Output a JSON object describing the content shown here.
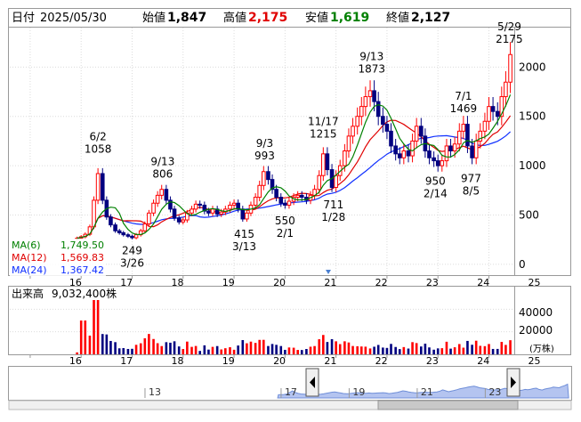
{
  "header": {
    "date_label": "日付",
    "date_value": "2025/05/30",
    "open_label": "始値",
    "open_value": "1,847",
    "high_label": "高値",
    "high_value": "2,175",
    "low_label": "安値",
    "low_value": "1,619",
    "close_label": "終値",
    "close_value": "2,127"
  },
  "colors": {
    "up": "#ff0000",
    "down": "#000080",
    "ma6": "#008000",
    "ma12": "#e00000",
    "ma24": "#1030ff",
    "high_text": "#e00000",
    "low_text": "#008000",
    "volume_up": "#ff0000",
    "volume_down": "#000080",
    "navigator_fill": "#b4c4f0"
  },
  "legend": [
    {
      "label": "MA(6)",
      "value": "1,749.50"
    },
    {
      "label": "MA(12)",
      "value": "1,569.83"
    },
    {
      "label": "MA(24)",
      "value": "1,367.42"
    }
  ],
  "volume_panel": {
    "label": "出来高",
    "value": "9,032,400株",
    "unit": "(万株)",
    "yticks": [
      "40000",
      "20000"
    ]
  },
  "chart_data": [
    {
      "type": "candlestick",
      "ylim": [
        -100,
        2400
      ],
      "yticks": [
        0,
        500,
        1000,
        1500,
        2000
      ],
      "x_tick_labels": [
        "16",
        "17",
        "18",
        "19",
        "20",
        "21",
        "22",
        "23",
        "24",
        "25"
      ],
      "x_tick_years": [
        2016,
        2017,
        2018,
        2019,
        2020,
        2021,
        2022,
        2023,
        2024,
        2025
      ],
      "x_range": [
        2015.6,
        2025.48
      ],
      "annotations": [
        {
          "date": "6/2",
          "value": "1058",
          "x": 2017.33,
          "y": 1058,
          "pos": "above"
        },
        {
          "date": "3/26",
          "value": "249",
          "x": 2018.0,
          "y": 249,
          "pos": "below"
        },
        {
          "date": "9/13",
          "value": "806",
          "x": 2018.6,
          "y": 806,
          "pos": "above"
        },
        {
          "date": "3/13",
          "value": "415",
          "x": 2020.2,
          "y": 415,
          "pos": "below"
        },
        {
          "date": "9/3",
          "value": "993",
          "x": 2020.6,
          "y": 993,
          "pos": "above"
        },
        {
          "date": "2/1",
          "value": "550",
          "x": 2021.0,
          "y": 550,
          "pos": "below"
        },
        {
          "date": "11/17",
          "value": "1215",
          "x": 2021.75,
          "y": 1215,
          "pos": "above"
        },
        {
          "date": "1/28",
          "value": "711",
          "x": 2021.95,
          "y": 711,
          "pos": "below"
        },
        {
          "date": "9/13",
          "value": "1873",
          "x": 2022.7,
          "y": 1873,
          "pos": "above"
        },
        {
          "date": "2/14",
          "value": "950",
          "x": 2023.95,
          "y": 950,
          "pos": "below"
        },
        {
          "date": "7/1",
          "value": "1469",
          "x": 2024.5,
          "y": 1469,
          "pos": "above"
        },
        {
          "date": "8/5",
          "value": "977",
          "x": 2024.65,
          "y": 977,
          "pos": "below"
        },
        {
          "date": "5/29",
          "value": "2175",
          "x": 2025.4,
          "y": 2175,
          "pos": "above"
        }
      ],
      "close_series_monthly": [
        [
          2016.92,
          265
        ],
        [
          2017.0,
          280
        ],
        [
          2017.08,
          305
        ],
        [
          2017.17,
          380
        ],
        [
          2017.25,
          650
        ],
        [
          2017.33,
          920
        ],
        [
          2017.42,
          650
        ],
        [
          2017.5,
          480
        ],
        [
          2017.58,
          400
        ],
        [
          2017.67,
          340
        ],
        [
          2017.75,
          320
        ],
        [
          2017.83,
          300
        ],
        [
          2017.92,
          285
        ],
        [
          2018.0,
          270
        ],
        [
          2018.08,
          300
        ],
        [
          2018.17,
          340
        ],
        [
          2018.25,
          410
        ],
        [
          2018.33,
          520
        ],
        [
          2018.42,
          620
        ],
        [
          2018.5,
          700
        ],
        [
          2018.58,
          760
        ],
        [
          2018.67,
          650
        ],
        [
          2018.75,
          560
        ],
        [
          2018.83,
          470
        ],
        [
          2018.92,
          430
        ],
        [
          2019.0,
          450
        ],
        [
          2019.08,
          520
        ],
        [
          2019.17,
          560
        ],
        [
          2019.25,
          610
        ],
        [
          2019.33,
          600
        ],
        [
          2019.42,
          540
        ],
        [
          2019.5,
          520
        ],
        [
          2019.58,
          560
        ],
        [
          2019.67,
          510
        ],
        [
          2019.75,
          530
        ],
        [
          2019.83,
          560
        ],
        [
          2019.92,
          600
        ],
        [
          2020.0,
          620
        ],
        [
          2020.08,
          560
        ],
        [
          2020.17,
          460
        ],
        [
          2020.25,
          520
        ],
        [
          2020.33,
          600
        ],
        [
          2020.42,
          680
        ],
        [
          2020.5,
          800
        ],
        [
          2020.58,
          940
        ],
        [
          2020.67,
          860
        ],
        [
          2020.75,
          760
        ],
        [
          2020.83,
          680
        ],
        [
          2020.92,
          620
        ],
        [
          2021.0,
          600
        ],
        [
          2021.08,
          640
        ],
        [
          2021.17,
          680
        ],
        [
          2021.25,
          700
        ],
        [
          2021.33,
          680
        ],
        [
          2021.42,
          650
        ],
        [
          2021.5,
          700
        ],
        [
          2021.58,
          760
        ],
        [
          2021.67,
          900
        ],
        [
          2021.75,
          1120
        ],
        [
          2021.83,
          960
        ],
        [
          2021.92,
          780
        ],
        [
          2022.0,
          900
        ],
        [
          2022.08,
          1000
        ],
        [
          2022.17,
          1150
        ],
        [
          2022.25,
          1300
        ],
        [
          2022.33,
          1400
        ],
        [
          2022.42,
          1500
        ],
        [
          2022.5,
          1600
        ],
        [
          2022.58,
          1700
        ],
        [
          2022.67,
          1760
        ],
        [
          2022.75,
          1650
        ],
        [
          2022.83,
          1500
        ],
        [
          2022.92,
          1420
        ],
        [
          2023.0,
          1350
        ],
        [
          2023.08,
          1200
        ],
        [
          2023.17,
          1120
        ],
        [
          2023.25,
          1080
        ],
        [
          2023.33,
          1150
        ],
        [
          2023.42,
          1100
        ],
        [
          2023.5,
          1250
        ],
        [
          2023.58,
          1400
        ],
        [
          2023.67,
          1300
        ],
        [
          2023.75,
          1150
        ],
        [
          2023.83,
          1080
        ],
        [
          2023.92,
          1050
        ],
        [
          2024.0,
          1000
        ],
        [
          2024.08,
          1050
        ],
        [
          2024.17,
          1200
        ],
        [
          2024.25,
          1150
        ],
        [
          2024.33,
          1220
        ],
        [
          2024.42,
          1350
        ],
        [
          2024.5,
          1420
        ],
        [
          2024.58,
          1200
        ],
        [
          2024.67,
          1080
        ],
        [
          2024.75,
          1250
        ],
        [
          2024.83,
          1350
        ],
        [
          2024.92,
          1450
        ],
        [
          2025.0,
          1600
        ],
        [
          2025.08,
          1550
        ],
        [
          2025.17,
          1500
        ],
        [
          2025.25,
          1700
        ],
        [
          2025.33,
          1847
        ],
        [
          2025.42,
          2127
        ]
      ]
    },
    {
      "type": "bar",
      "name": "volume",
      "ylim": [
        0,
        60000
      ],
      "x_tick_labels": [
        "16",
        "17",
        "18",
        "19",
        "20",
        "21",
        "22",
        "23",
        "24",
        "25"
      ]
    }
  ],
  "navigator": {
    "tick_labels": [
      "13",
      "17",
      "19",
      "21",
      "23"
    ],
    "tick_years": [
      2013,
      2017,
      2019,
      2021,
      2023
    ]
  }
}
